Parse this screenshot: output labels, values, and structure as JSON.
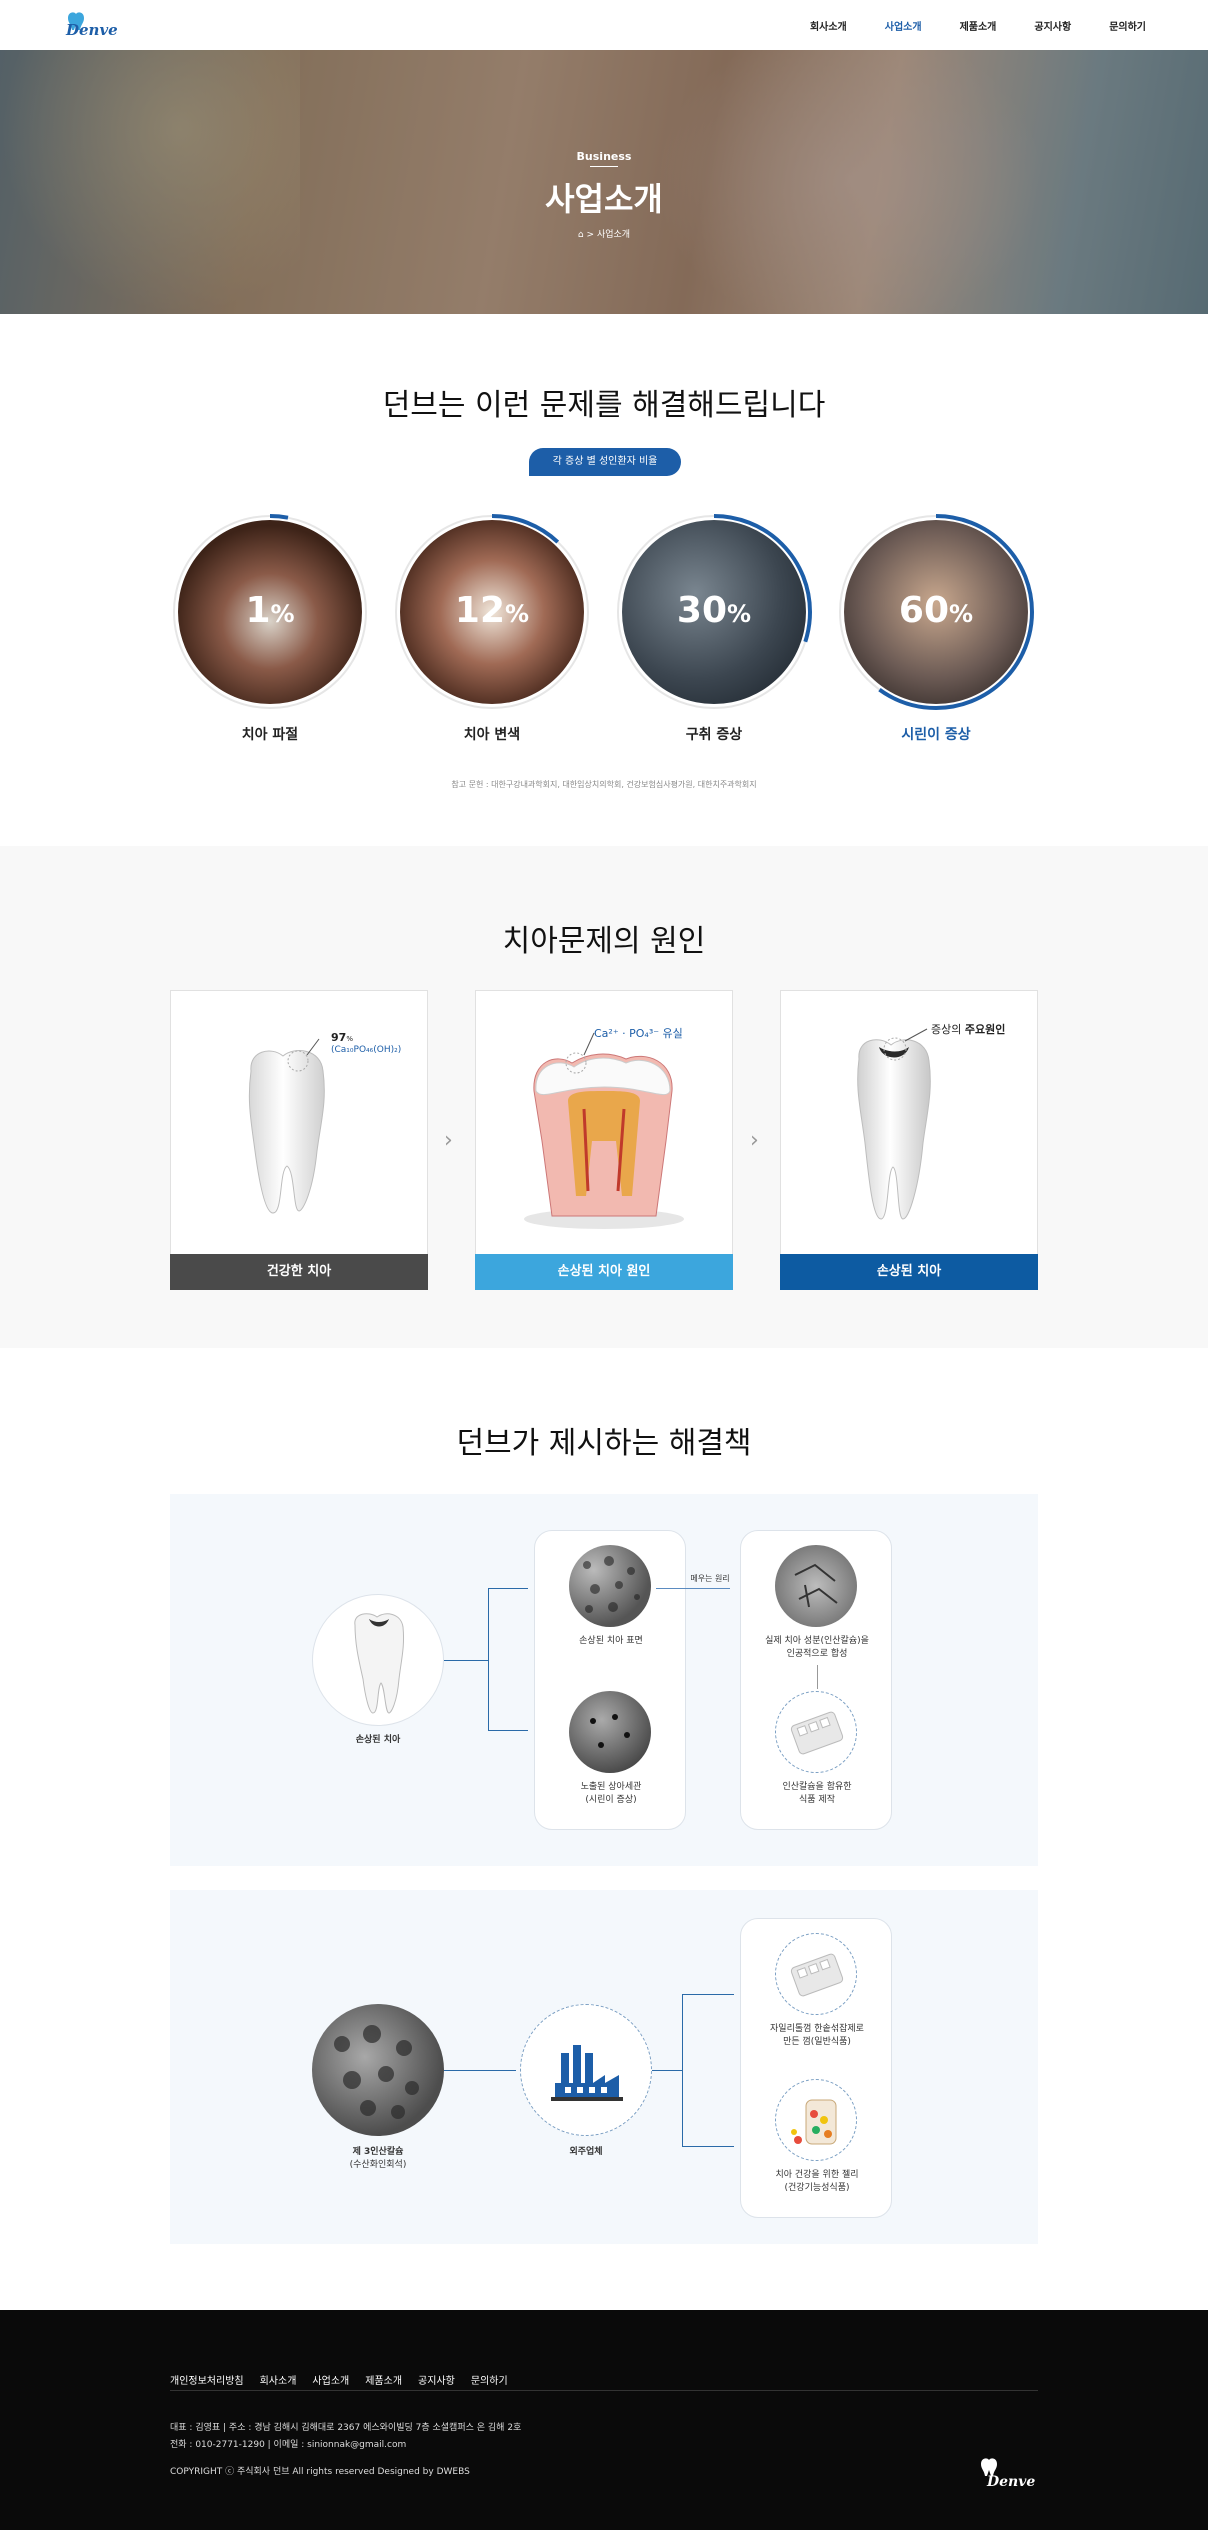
{
  "header": {
    "logo_text": "Denve",
    "nav": [
      "회사소개",
      "사업소개",
      "제품소개",
      "공지사항",
      "문의하기"
    ],
    "active_index": 1
  },
  "hero": {
    "subtitle": "Business",
    "title": "사업소개",
    "breadcrumb": "사업소개",
    "breadcrumb_sep": ">"
  },
  "problems": {
    "title": "던브는 이런 문제를 해결해드립니다",
    "pill": "각 증상 별 성인환자 비율",
    "stats": [
      {
        "value": "1",
        "unit": "%",
        "label": "치아 파절",
        "percent": 1
      },
      {
        "value": "12",
        "unit": "%",
        "label": "치아 변색",
        "percent": 12
      },
      {
        "value": "30",
        "unit": "%",
        "label": "구취 증상",
        "percent": 30
      },
      {
        "value": "60",
        "unit": "%",
        "label": "시린이 증상",
        "percent": 60
      }
    ],
    "note": "참고 문헌 : 대한구강내과학회지, 대한임상치의학회, 건강보험심사평가원, 대한치주과학회지"
  },
  "causes": {
    "title": "치아문제의 원인",
    "cards": [
      {
        "label": "건강한 치아",
        "color": "#4a4a4a",
        "callout_main": "97",
        "callout_unit": "%",
        "callout_formula": "(Ca₁₀PO₄₆(OH)₂)"
      },
      {
        "label": "손상된 치아 원인",
        "color": "#3ca6dd",
        "callout_main": "Ca²⁺ · PO₄³⁻ 유실"
      },
      {
        "label": "손상된 치아",
        "color": "#0d5ba2",
        "callout_main": "증상의 ",
        "callout_bold": "주요원인"
      }
    ]
  },
  "solution": {
    "title": "던브가 제시하는 해결책",
    "panel1": {
      "damaged_tooth": "손상된 치아",
      "surface": "손상된 치아 표면",
      "dentin": "노출된 상아세관",
      "dentin_sub": "(시린이 증상)",
      "fill_principle": "메우는 원리",
      "hydroxy": "실제 치아 성분(인산칼슘)을",
      "hydroxy2": "인공적으로 합성",
      "material": "인산칼슘을 함유한",
      "material2": "식품 제작"
    },
    "panel2": {
      "calcium": "제 3인산칼슘",
      "calcium_sub": "(수산화인회석)",
      "factory": "외주업체",
      "product1": "자일리톨껌 한솥섞잡제로",
      "product1b": "만든 껌(일반식품)",
      "product2": "치아 건강을 위한 젤리",
      "product2b": "(건강기능성식품)"
    }
  },
  "footer": {
    "nav": [
      "개인정보처리방침",
      "회사소개",
      "사업소개",
      "제품소개",
      "공지사항",
      "문의하기"
    ],
    "line1": "대표 : 김영표 | 주소 : 경남 김해시 김해대로 2367 에스와이빌딩 7층 소셜캠퍼스 온 김해 2호",
    "line2": "전화 : 010-2771-1290  |  이메일 : sinionnak@gmail.com",
    "copyright": "COPYRIGHT ⓒ 주식회사 던브 All rights reserved Designed by DWEBS",
    "logo_text": "Denve"
  },
  "colors": {
    "brand": "#1d5ea8",
    "light_blue": "#3ca6dd",
    "dark_gray": "#4a4a4a"
  }
}
